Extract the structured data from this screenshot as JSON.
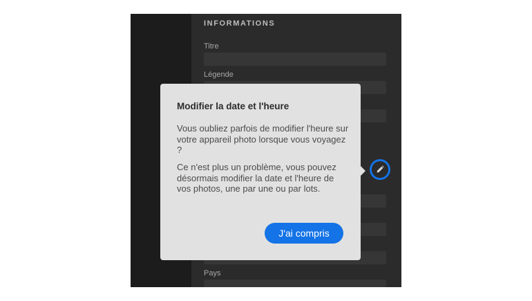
{
  "info_panel": {
    "section_title": "INFORMATIONS",
    "fields": [
      {
        "label": "Titre"
      },
      {
        "label": "Légende"
      },
      {
        "label": "Pays"
      }
    ]
  },
  "edit_date_button": {
    "icon": "pencil-icon",
    "accent_color": "#1473e6"
  },
  "popover": {
    "title": "Modifier la date et l'heure",
    "paragraph_1": "Vous oubliez parfois de modifier l'heure sur votre appareil photo lorsque vous voyagez ?",
    "paragraph_2": "Ce n'est plus un problème, vous pouvez désormais modifier la date et l'heure de vos photos, une par une ou par lots.",
    "confirm_label": "J'ai compris"
  },
  "colors": {
    "accent": "#1473e6",
    "popover_background": "#e1e1e1",
    "panel_background": "#2b2b2b"
  }
}
